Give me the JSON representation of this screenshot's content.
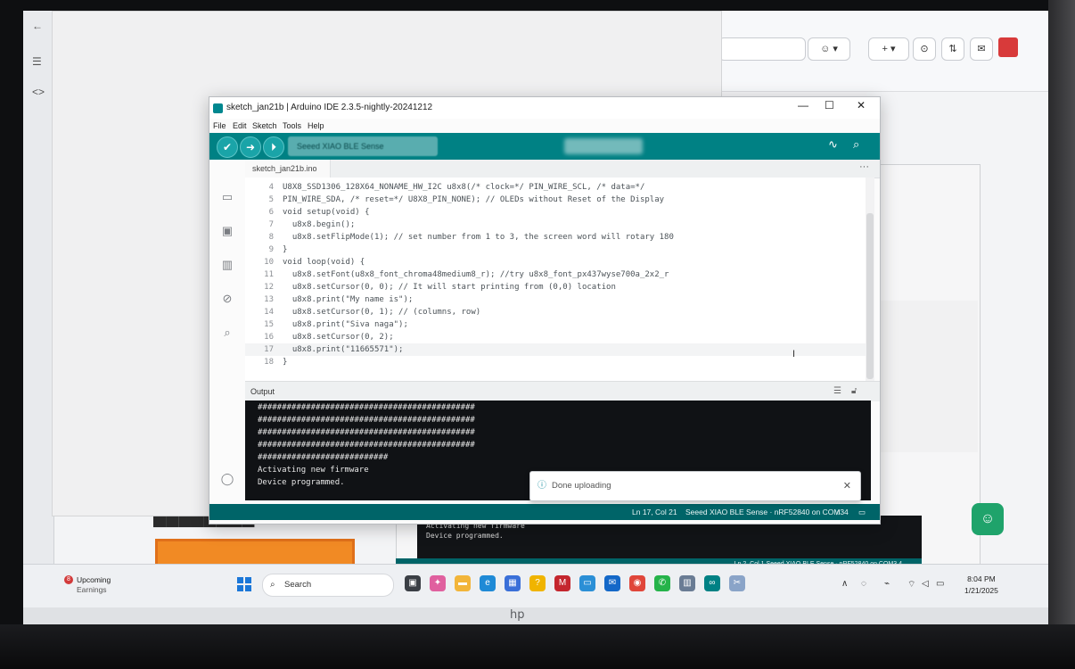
{
  "window": {
    "title": "sketch_jan21b | Arduino IDE 2.3.5-nightly-20241212",
    "minimize_glyph": "—",
    "maximize_glyph": "☐",
    "close_glyph": "✕"
  },
  "menu": [
    "File",
    "Edit",
    "Sketch",
    "Tools",
    "Help"
  ],
  "toolbar": {
    "verify_glyph": "✔",
    "upload_glyph": "➜",
    "debug_glyph": "⏵",
    "board": "Seeed XIAO BLE Sense",
    "serial_plotter_glyph": "∿",
    "serial_monitor_glyph": "⌕"
  },
  "tab": {
    "file_name": "sketch_jan21b.ino",
    "more": "···"
  },
  "code_lines": [
    {
      "n": "4",
      "text": "U8X8_SSD1306_128X64_NONAME_HW_I2C u8x8(/* clock=*/ PIN_WIRE_SCL, /* data=*/"
    },
    {
      "n": "5",
      "text": "PIN_WIRE_SDA, /* reset=*/ U8X8_PIN_NONE); // OLEDs without Reset of the Display"
    },
    {
      "n": "6",
      "text": "void setup(void) {"
    },
    {
      "n": "7",
      "text": "  u8x8.begin();"
    },
    {
      "n": "8",
      "text": "  u8x8.setFlipMode(1); // set number from 1 to 3, the screen word will rotary 180"
    },
    {
      "n": "9",
      "text": "}"
    },
    {
      "n": "10",
      "text": "void loop(void) {"
    },
    {
      "n": "11",
      "text": "  u8x8.setFont(u8x8_font_chroma48medium8_r); //try u8x8_font_px437wyse700a_2x2_r"
    },
    {
      "n": "12",
      "text": "  u8x8.setCursor(0, 0); // It will start printing from (0,0) location"
    },
    {
      "n": "13",
      "text": "  u8x8.print(\"My name is\");"
    },
    {
      "n": "14",
      "text": "  u8x8.setCursor(0, 1); // (columns, row)"
    },
    {
      "n": "15",
      "text": "  u8x8.print(\"Siva naga\");"
    },
    {
      "n": "16",
      "text": "  u8x8.setCursor(0, 2);"
    },
    {
      "n": "17",
      "text": "  u8x8.print(\"11665571\");"
    },
    {
      "n": "18",
      "text": "}"
    }
  ],
  "output": {
    "title": "Output",
    "lines": [
      "#############################################",
      "#############################################",
      "#############################################",
      "#############################################",
      "###########################",
      "Activating new firmware",
      "Device programmed."
    ]
  },
  "status": {
    "position": "Ln 17, Col 21",
    "board_port": "Seeed XIAO BLE Sense · nRF52840 on COM3",
    "notifications": "4"
  },
  "toast": {
    "message": "Done uploading",
    "close_glyph": "✕"
  },
  "background_ide": {
    "output_lines": [
      "Activating new firmware",
      "Device programmed."
    ],
    "status_text": "Ln 2, Col 1    Seeed XIAO BLE Sense · nRF52840 on COM3    4"
  },
  "taskbar": {
    "widget_badge": "8",
    "widget_title": "Upcoming",
    "widget_subtitle": "Earnings",
    "search_label": "Search",
    "time": "8:04 PM",
    "date": "1/21/2025"
  },
  "colors": {
    "toolbar": "#008184",
    "status_bar": "#006468",
    "terminal_bg": "#101215"
  }
}
